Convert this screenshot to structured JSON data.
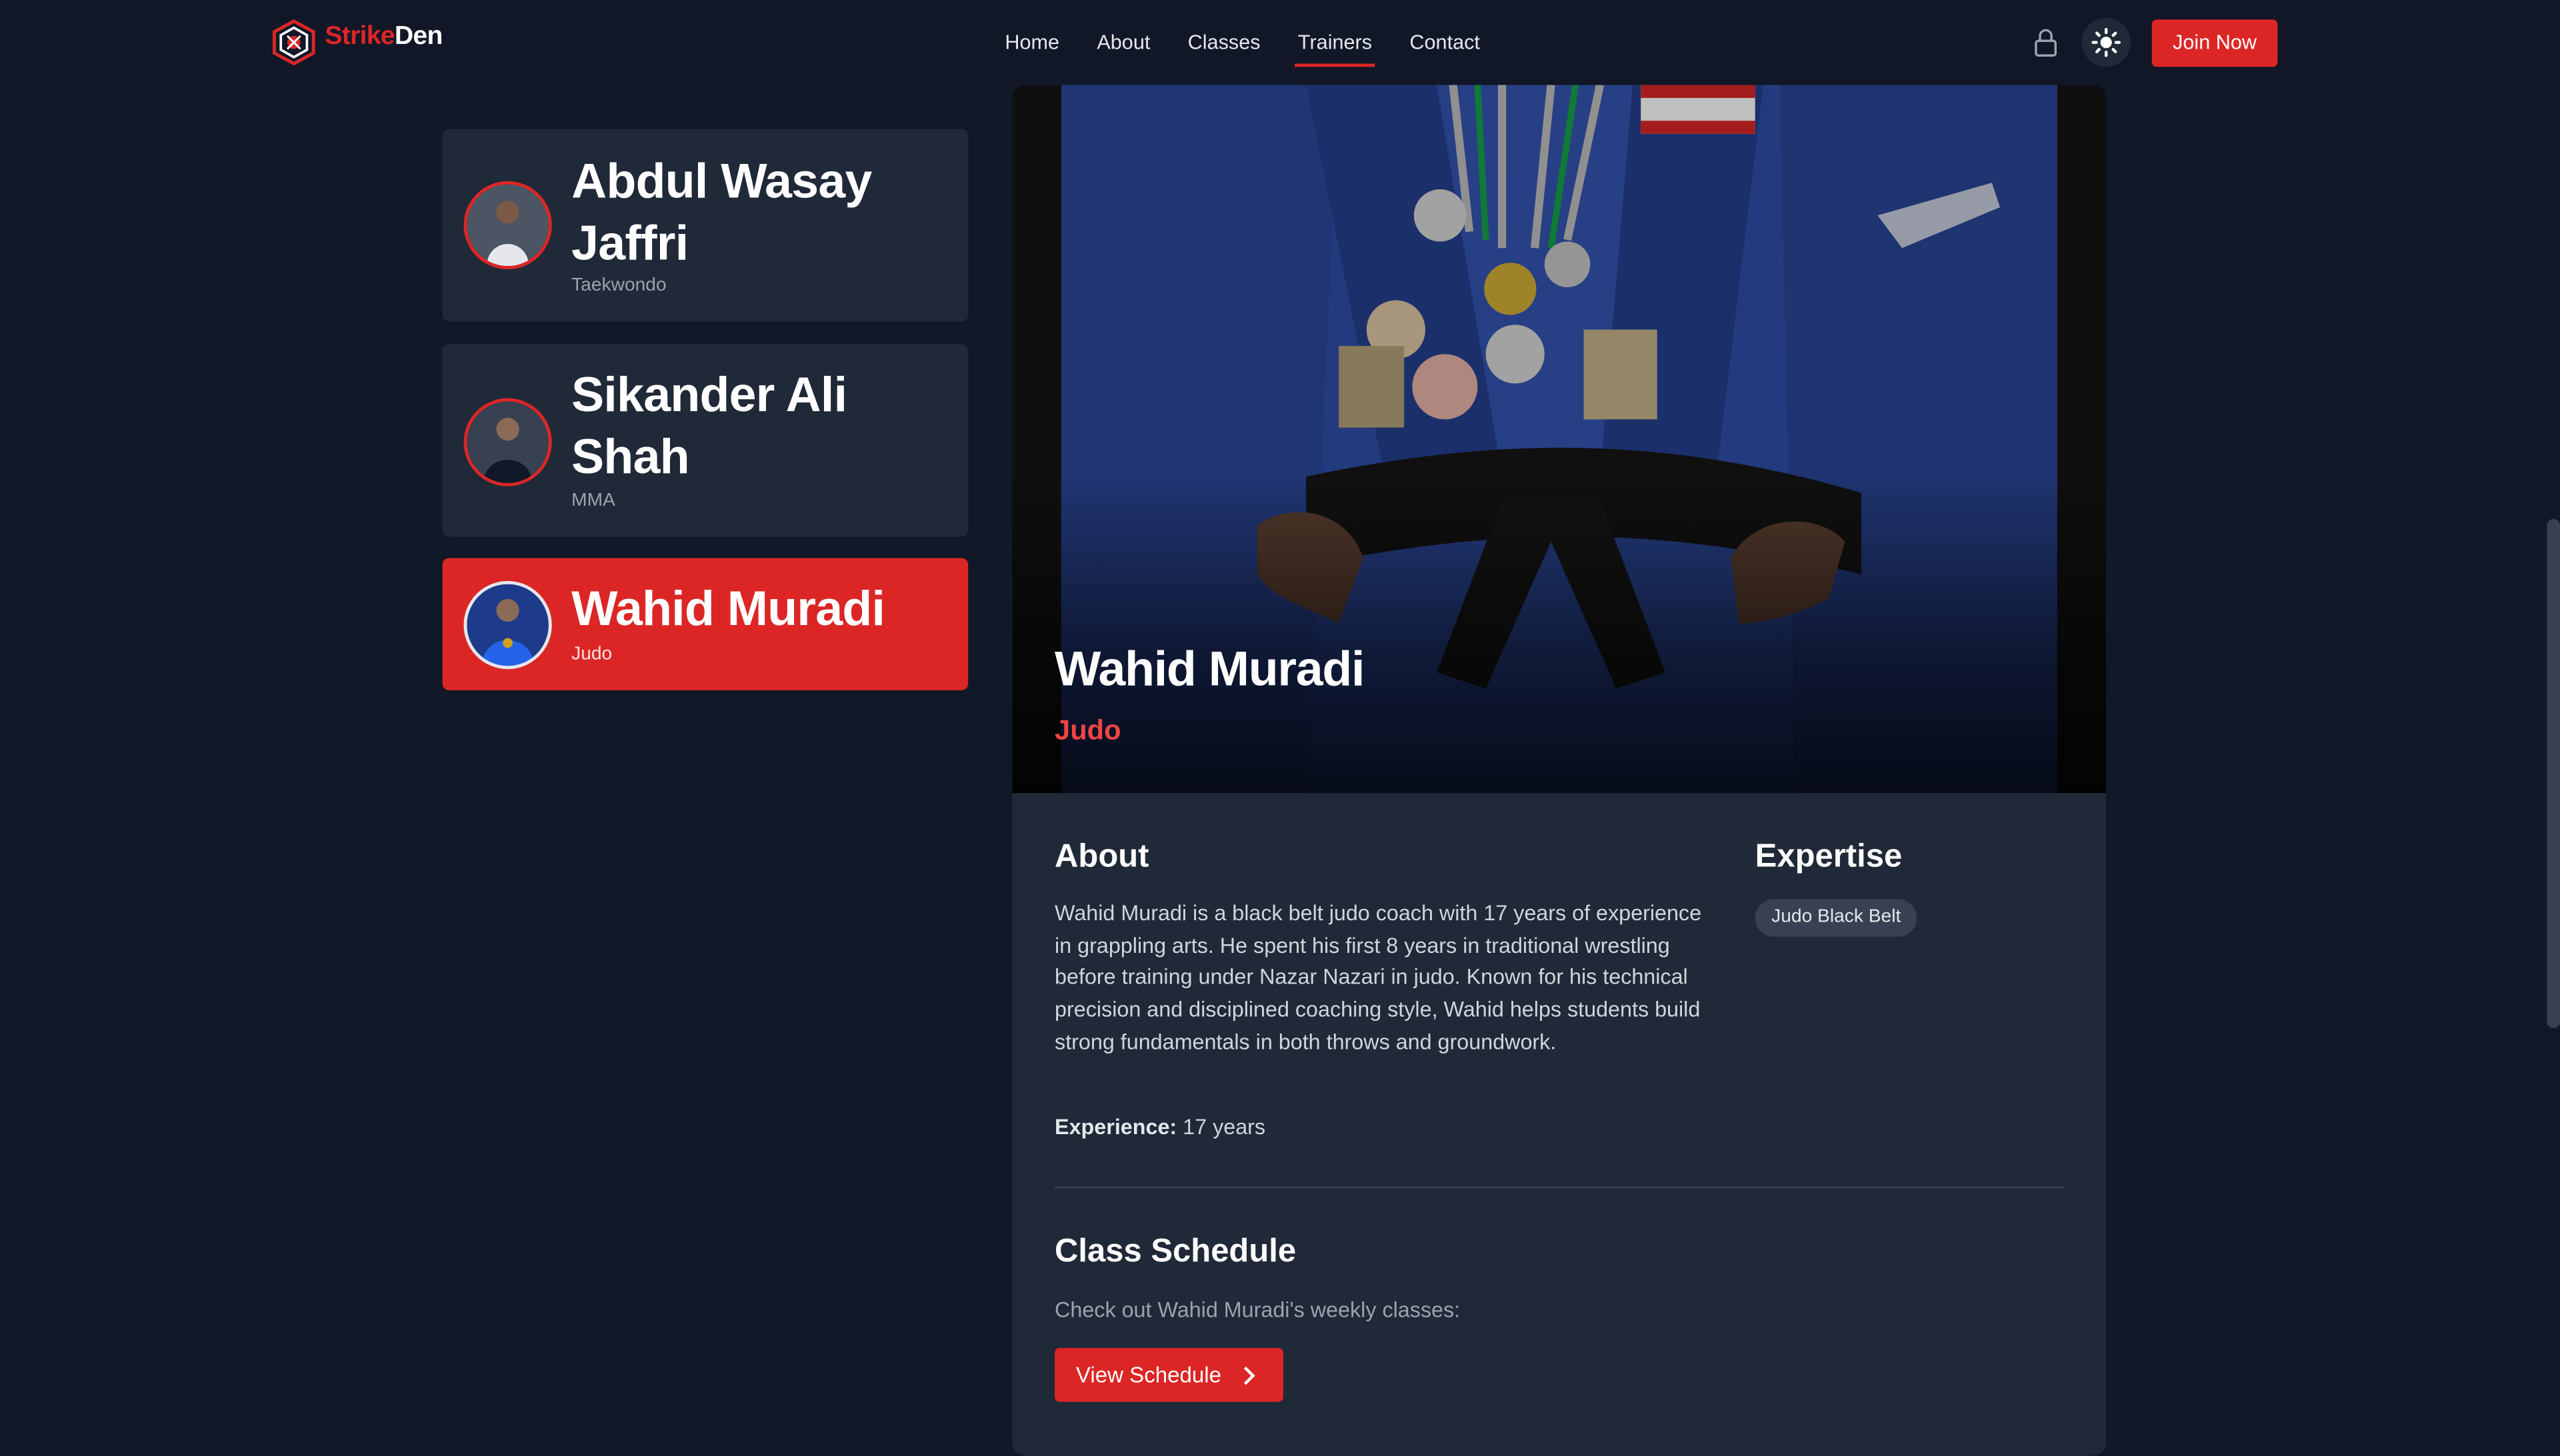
{
  "nav": {
    "brand_part1": "Strike",
    "brand_part2": "Den",
    "links": [
      "Home",
      "About",
      "Classes",
      "Trainers",
      "Contact"
    ],
    "active_link": "Trainers",
    "join_label": "Join Now",
    "icons": [
      "lock-icon",
      "sun-icon"
    ]
  },
  "colors": {
    "accent": "#dc2626",
    "background": "#111827",
    "card": "#1f2937"
  },
  "trainers": [
    {
      "name": "Abdul Wasay Jaffri",
      "name_line1": "Abdul Wasay",
      "name_line2": "Jaffri",
      "art": "Taekwondo"
    },
    {
      "name": "Sikander Ali Shah",
      "name_line1": "Sikander Ali",
      "name_line2": "Shah",
      "art": "MMA"
    },
    {
      "name": "Wahid Muradi",
      "art": "Judo",
      "selected": true
    }
  ],
  "detail": {
    "name": "Wahid Muradi",
    "art": "Judo",
    "about_heading": "About",
    "bio": "Wahid Muradi is a black belt judo coach with 17 years of experience in grappling arts. He spent his first 8 years in traditional wrestling before training under Nazar Nazari in judo. Known for his technical precision and disciplined coaching style, Wahid helps students build strong fundamentals in both throws and groundwork.",
    "experience_label": "Experience:",
    "experience_value": "17 years",
    "expertise_heading": "Expertise",
    "expertise": [
      "Judo Black Belt"
    ],
    "schedule_heading": "Class Schedule",
    "schedule_text": "Check out Wahid Muradi's weekly classes:",
    "schedule_button": "View Schedule"
  }
}
